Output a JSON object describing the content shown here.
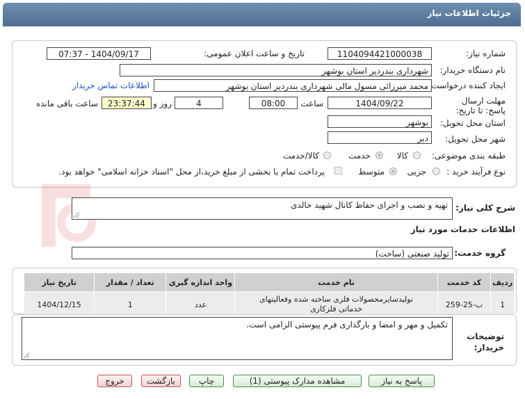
{
  "header": {
    "title": "جزئیات اطلاعات نیاز"
  },
  "form": {
    "need_number_label": "شماره نیاز:",
    "need_number": "1104094421000038",
    "announce_label": "تاریخ و ساعت اعلان عمومی:",
    "announce_value": "1404/09/17 - 07:37",
    "buyer_org_label": "نام دستگاه خریدار:",
    "buyer_org": "شهرداری بندردیر استان بوشهر",
    "creator_label": "ایجاد کننده درخواست:",
    "creator": "محمد میرزائی مسول مالی شهرداری بندردیر استان بوشهر",
    "contact_link": "اطلاعات تماس خریدار",
    "deadline_label": "مهلت ارسال پاسخ: تا تاریخ:",
    "deadline_date": "1404/09/22",
    "time_label": "ساعت",
    "deadline_time": "08:00",
    "days_value": "4",
    "days_label": "روز و",
    "remaining_time": "23:37:44",
    "remaining_label": "ساعت باقی مانده",
    "province_label": "استان محل تحویل:",
    "province": "بوشهر",
    "city_label": "شهر محل تحویل:",
    "city": "دیر",
    "category_label": "طبقه بندی موضوعی:",
    "category_options": [
      "کالا",
      "خدمت",
      "کالا/خدمت"
    ],
    "purchase_type_label": "نوع فرآیند خرید :",
    "purchase_options": [
      "جزیی",
      "متوسط"
    ],
    "payment_note": "پرداخت تمام یا بخشی از مبلغ خرید،از محل \"اسناد خزانه اسلامی\" خواهد بود."
  },
  "summary": {
    "label": "شرح کلی نیاز:",
    "value": "تهیه و نصب و اجرای حفاظ کانال شهید خالدی"
  },
  "services": {
    "section_title": "اطلاعات خدمات مورد نیاز",
    "group_label": "گروه خدمت:",
    "group_value": "تولید صنعتی (ساخت)",
    "columns": [
      "ردیف",
      "کد خدمت",
      "نام خدمت",
      "واحد اندازه گیری",
      "تعداد / مقدار",
      "تاریخ نیاز"
    ],
    "rows": [
      [
        "1",
        "ب-25-259",
        "تولیدسایرمحصولات فلزی ساخته شده وفعالیتهای خدماتی فلزکاری",
        "عدد",
        "1",
        "1404/12/15"
      ]
    ]
  },
  "notes": {
    "label": "توضیحات خریدار:",
    "value": "تکمیل و مهر و امضا و بارگذاری فرم پیوستی الزامی است."
  },
  "buttons": {
    "reply": "پاسخ به نیاز",
    "attachments": "مشاهده مدارک پیوستی (1)",
    "print": "چاپ",
    "back": "بازگشت",
    "exit": "خروج"
  }
}
